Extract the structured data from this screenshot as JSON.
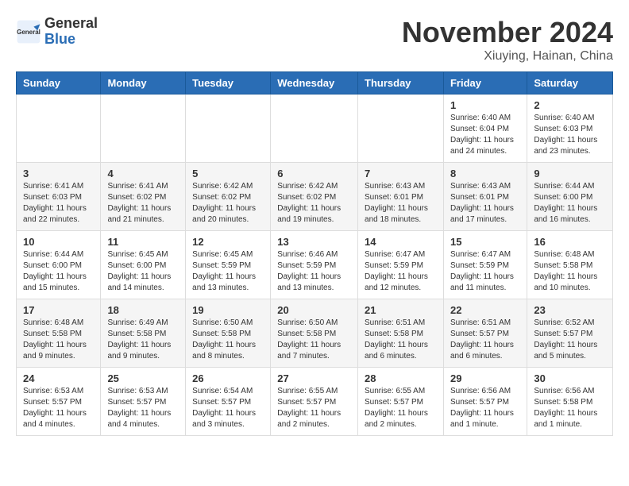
{
  "header": {
    "logo": {
      "general": "General",
      "blue": "Blue"
    },
    "month_title": "November 2024",
    "location": "Xiuying, Hainan, China"
  },
  "weekdays": [
    "Sunday",
    "Monday",
    "Tuesday",
    "Wednesday",
    "Thursday",
    "Friday",
    "Saturday"
  ],
  "weeks": [
    [
      {
        "day": "",
        "info": ""
      },
      {
        "day": "",
        "info": ""
      },
      {
        "day": "",
        "info": ""
      },
      {
        "day": "",
        "info": ""
      },
      {
        "day": "",
        "info": ""
      },
      {
        "day": "1",
        "info": "Sunrise: 6:40 AM\nSunset: 6:04 PM\nDaylight: 11 hours\nand 24 minutes."
      },
      {
        "day": "2",
        "info": "Sunrise: 6:40 AM\nSunset: 6:03 PM\nDaylight: 11 hours\nand 23 minutes."
      }
    ],
    [
      {
        "day": "3",
        "info": "Sunrise: 6:41 AM\nSunset: 6:03 PM\nDaylight: 11 hours\nand 22 minutes."
      },
      {
        "day": "4",
        "info": "Sunrise: 6:41 AM\nSunset: 6:02 PM\nDaylight: 11 hours\nand 21 minutes."
      },
      {
        "day": "5",
        "info": "Sunrise: 6:42 AM\nSunset: 6:02 PM\nDaylight: 11 hours\nand 20 minutes."
      },
      {
        "day": "6",
        "info": "Sunrise: 6:42 AM\nSunset: 6:02 PM\nDaylight: 11 hours\nand 19 minutes."
      },
      {
        "day": "7",
        "info": "Sunrise: 6:43 AM\nSunset: 6:01 PM\nDaylight: 11 hours\nand 18 minutes."
      },
      {
        "day": "8",
        "info": "Sunrise: 6:43 AM\nSunset: 6:01 PM\nDaylight: 11 hours\nand 17 minutes."
      },
      {
        "day": "9",
        "info": "Sunrise: 6:44 AM\nSunset: 6:00 PM\nDaylight: 11 hours\nand 16 minutes."
      }
    ],
    [
      {
        "day": "10",
        "info": "Sunrise: 6:44 AM\nSunset: 6:00 PM\nDaylight: 11 hours\nand 15 minutes."
      },
      {
        "day": "11",
        "info": "Sunrise: 6:45 AM\nSunset: 6:00 PM\nDaylight: 11 hours\nand 14 minutes."
      },
      {
        "day": "12",
        "info": "Sunrise: 6:45 AM\nSunset: 5:59 PM\nDaylight: 11 hours\nand 13 minutes."
      },
      {
        "day": "13",
        "info": "Sunrise: 6:46 AM\nSunset: 5:59 PM\nDaylight: 11 hours\nand 13 minutes."
      },
      {
        "day": "14",
        "info": "Sunrise: 6:47 AM\nSunset: 5:59 PM\nDaylight: 11 hours\nand 12 minutes."
      },
      {
        "day": "15",
        "info": "Sunrise: 6:47 AM\nSunset: 5:59 PM\nDaylight: 11 hours\nand 11 minutes."
      },
      {
        "day": "16",
        "info": "Sunrise: 6:48 AM\nSunset: 5:58 PM\nDaylight: 11 hours\nand 10 minutes."
      }
    ],
    [
      {
        "day": "17",
        "info": "Sunrise: 6:48 AM\nSunset: 5:58 PM\nDaylight: 11 hours\nand 9 minutes."
      },
      {
        "day": "18",
        "info": "Sunrise: 6:49 AM\nSunset: 5:58 PM\nDaylight: 11 hours\nand 9 minutes."
      },
      {
        "day": "19",
        "info": "Sunrise: 6:50 AM\nSunset: 5:58 PM\nDaylight: 11 hours\nand 8 minutes."
      },
      {
        "day": "20",
        "info": "Sunrise: 6:50 AM\nSunset: 5:58 PM\nDaylight: 11 hours\nand 7 minutes."
      },
      {
        "day": "21",
        "info": "Sunrise: 6:51 AM\nSunset: 5:58 PM\nDaylight: 11 hours\nand 6 minutes."
      },
      {
        "day": "22",
        "info": "Sunrise: 6:51 AM\nSunset: 5:57 PM\nDaylight: 11 hours\nand 6 minutes."
      },
      {
        "day": "23",
        "info": "Sunrise: 6:52 AM\nSunset: 5:57 PM\nDaylight: 11 hours\nand 5 minutes."
      }
    ],
    [
      {
        "day": "24",
        "info": "Sunrise: 6:53 AM\nSunset: 5:57 PM\nDaylight: 11 hours\nand 4 minutes."
      },
      {
        "day": "25",
        "info": "Sunrise: 6:53 AM\nSunset: 5:57 PM\nDaylight: 11 hours\nand 4 minutes."
      },
      {
        "day": "26",
        "info": "Sunrise: 6:54 AM\nSunset: 5:57 PM\nDaylight: 11 hours\nand 3 minutes."
      },
      {
        "day": "27",
        "info": "Sunrise: 6:55 AM\nSunset: 5:57 PM\nDaylight: 11 hours\nand 2 minutes."
      },
      {
        "day": "28",
        "info": "Sunrise: 6:55 AM\nSunset: 5:57 PM\nDaylight: 11 hours\nand 2 minutes."
      },
      {
        "day": "29",
        "info": "Sunrise: 6:56 AM\nSunset: 5:57 PM\nDaylight: 11 hours\nand 1 minute."
      },
      {
        "day": "30",
        "info": "Sunrise: 6:56 AM\nSunset: 5:58 PM\nDaylight: 11 hours\nand 1 minute."
      }
    ]
  ]
}
